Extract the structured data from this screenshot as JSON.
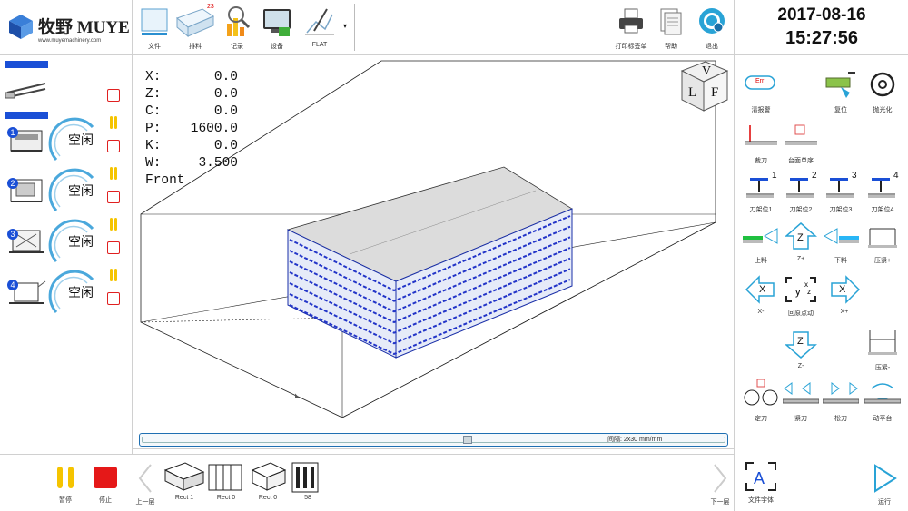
{
  "brand": {
    "name": "牧野 MUYE",
    "url": "www.muyemachinery.com"
  },
  "toolbar": {
    "items": [
      {
        "label": "文件",
        "icon": "file-box-icon"
      },
      {
        "label": "排料",
        "badge": "23",
        "icon": "nesting-sheet-icon"
      },
      {
        "label": "记录",
        "icon": "report-chart-icon"
      },
      {
        "label": "设备",
        "icon": "monitor-icon"
      },
      {
        "label": "FLAT",
        "icon": "draw-tool-icon"
      }
    ],
    "right_items": [
      {
        "label": "打印标签单",
        "icon": "printer-icon"
      },
      {
        "label": "帮助",
        "icon": "help-doc-icon"
      },
      {
        "label": "退出",
        "icon": "power-exit-icon"
      }
    ]
  },
  "datetime": {
    "date": "2017-08-16",
    "time": "15:27:56"
  },
  "stations": [
    {
      "number": "1",
      "status": "空闲"
    },
    {
      "number": "2",
      "status": "空闲"
    },
    {
      "number": "3",
      "status": "空闲"
    },
    {
      "number": "4",
      "status": "空闲"
    }
  ],
  "readout": [
    {
      "axis": "X:",
      "value": "0.0"
    },
    {
      "axis": "Z:",
      "value": "0.0"
    },
    {
      "axis": "C:",
      "value": "0.0"
    },
    {
      "axis": "P:",
      "value": "1600.0"
    },
    {
      "axis": "K:",
      "value": "0.0"
    },
    {
      "axis": "W:",
      "value": "3.500"
    }
  ],
  "view_name": "Front",
  "view_cube": {
    "top": "V",
    "left": "L",
    "right": "F"
  },
  "scale_text": "间隔: 2x30 mm/mm",
  "right_panel": {
    "row1": [
      {
        "label": "清报警",
        "badge": "Err",
        "icon": "error-clear-icon"
      },
      {
        "label": "复位",
        "icon": "reset-icon"
      },
      {
        "label": "抛光化",
        "icon": "polish-icon"
      }
    ],
    "row2": [
      {
        "label": "裁刀",
        "icon": "knife-icon"
      },
      {
        "label": "台面单序",
        "icon": "table-sequence-icon"
      }
    ],
    "row3": [
      {
        "label": "刀架位1",
        "num": "1",
        "icon": "toolholder-icon"
      },
      {
        "label": "刀架位2",
        "num": "2",
        "icon": "toolholder-icon"
      },
      {
        "label": "刀架位3",
        "num": "3",
        "icon": "toolholder-icon"
      },
      {
        "label": "刀架位4",
        "num": "4",
        "icon": "toolholder-icon"
      }
    ],
    "row4": [
      {
        "label": "上料",
        "icon": "load-icon"
      },
      {
        "label": "Z+",
        "axis": "Z",
        "icon": "arrow-up-icon"
      },
      {
        "label": "下料",
        "icon": "unload-icon"
      },
      {
        "label": "压紧+",
        "icon": "clamp-up-icon"
      }
    ],
    "row5": [
      {
        "label": "X-",
        "axis": "X",
        "icon": "arrow-left-icon"
      },
      {
        "label": "回原点动",
        "icon": "home-xyz-icon"
      },
      {
        "label": "X+",
        "axis": "X",
        "icon": "arrow-right-icon"
      }
    ],
    "row6": [
      {
        "label": "Z-",
        "axis": "Z",
        "icon": "arrow-down-icon"
      },
      {
        "label": "压紧-",
        "icon": "clamp-down-icon"
      }
    ],
    "row7": [
      {
        "label": "定刀",
        "icon": "wheels-icon"
      },
      {
        "label": "紧刀",
        "icon": "tighten-left-icon"
      },
      {
        "label": "松刀",
        "icon": "release-right-icon"
      },
      {
        "label": "动平台",
        "icon": "platform-icon"
      }
    ]
  },
  "bottom": {
    "pause_label": "暂停",
    "stop_label": "停止",
    "prev_label": "上一层",
    "next_label": "下一层",
    "layers": [
      {
        "label": "Rect 1"
      },
      {
        "label": "Rect 0"
      },
      {
        "label": "Rect 0"
      },
      {
        "label": "58"
      }
    ],
    "font_label": "文件字体",
    "run_label": "运行"
  },
  "colors": {
    "accent": "#1a4fd6",
    "stop": "#e51818",
    "pause": "#f5c400",
    "cyan": "#29a3d6"
  }
}
